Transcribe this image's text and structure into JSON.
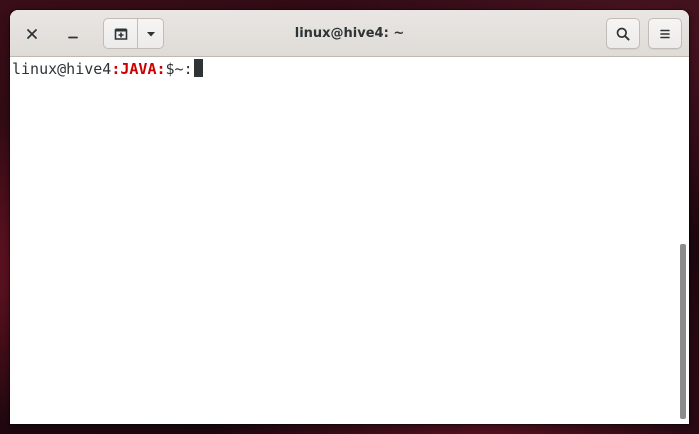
{
  "window": {
    "title": "linux@hive4: ~"
  },
  "headerbar": {
    "close_icon": "close-icon",
    "minimize_icon": "minimize-icon",
    "new_tab_icon": "new-tab-icon",
    "new_tab_menu_icon": "chevron-down-icon",
    "search_icon": "search-icon",
    "menu_icon": "hamburger-menu-icon"
  },
  "terminal": {
    "prompt_user_host": "linux@hive4",
    "prompt_sep1": ":",
    "prompt_tag": "JAVA",
    "prompt_sep2": ":",
    "prompt_tail": "$~:",
    "input": ""
  },
  "colors": {
    "prompt_tag": "#cc0000",
    "text": "#2e3436",
    "background": "#ffffff",
    "headerbar": "#e4e1de"
  }
}
